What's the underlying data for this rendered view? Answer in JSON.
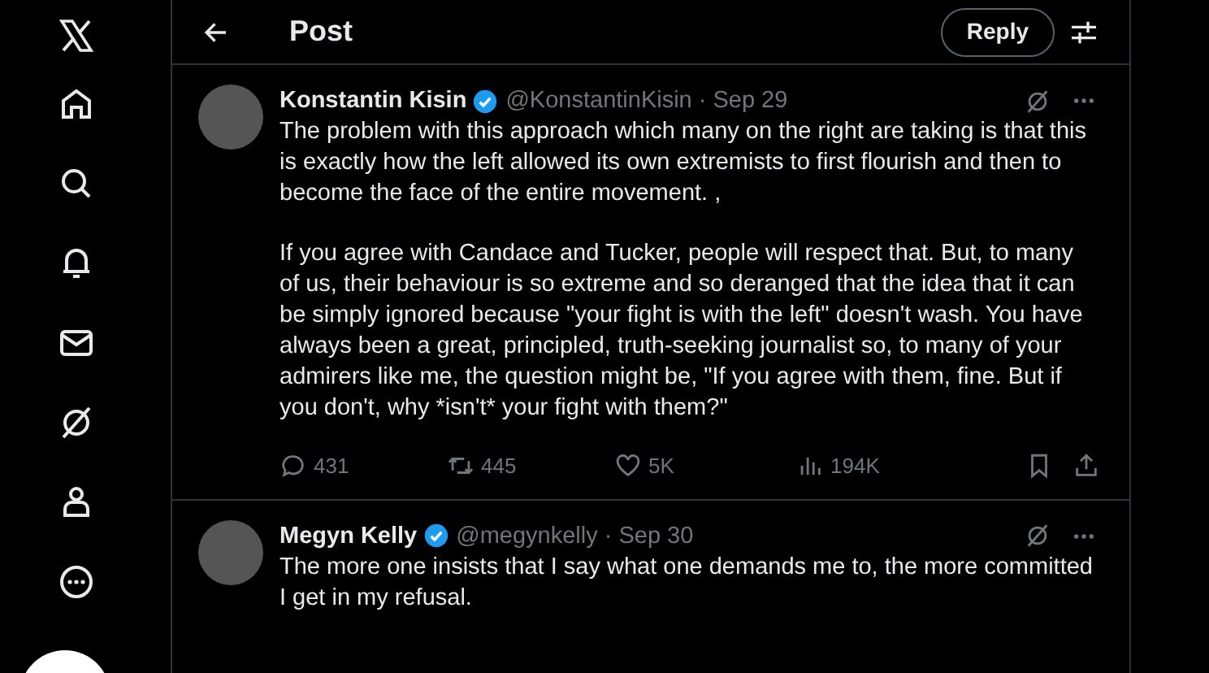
{
  "header": {
    "title": "Post",
    "reply_button": "Reply"
  },
  "sidebar": {
    "items": [
      {
        "kind": "home"
      },
      {
        "kind": "search"
      },
      {
        "kind": "bell"
      },
      {
        "kind": "mail"
      },
      {
        "kind": "slash"
      },
      {
        "kind": "person"
      },
      {
        "kind": "more"
      }
    ]
  },
  "posts": [
    {
      "name": "Konstantin Kisin",
      "verified": true,
      "handle": "@KonstantinKisin",
      "date": "· Sep 29",
      "paragraphs": [
        "The problem with this approach which many on the right are taking is that this is exactly how the left allowed its own extremists to first flourish and then to become the face of the entire movement. ,",
        "If you agree with Candace and Tucker, people will respect that. But, to many of us, their behaviour is so extreme and so deranged that the idea that it can be simply ignored because \"your fight is with the left\" doesn't wash. You have always been a great, principled, truth-seeking journalist so, to many of your admirers like me, the question might be, \"If you agree with them, fine. But if you don't, why *isn't* your fight with them?\""
      ],
      "stats": {
        "replies": "431",
        "reposts": "445",
        "likes": "5K",
        "views": "194K"
      }
    },
    {
      "name": "Megyn Kelly",
      "verified": true,
      "handle": "@megynkelly",
      "date": "· Sep 30",
      "paragraphs": [
        "The more one insists that I say what one demands me to, the more committed I get in my refusal."
      ]
    }
  ]
}
